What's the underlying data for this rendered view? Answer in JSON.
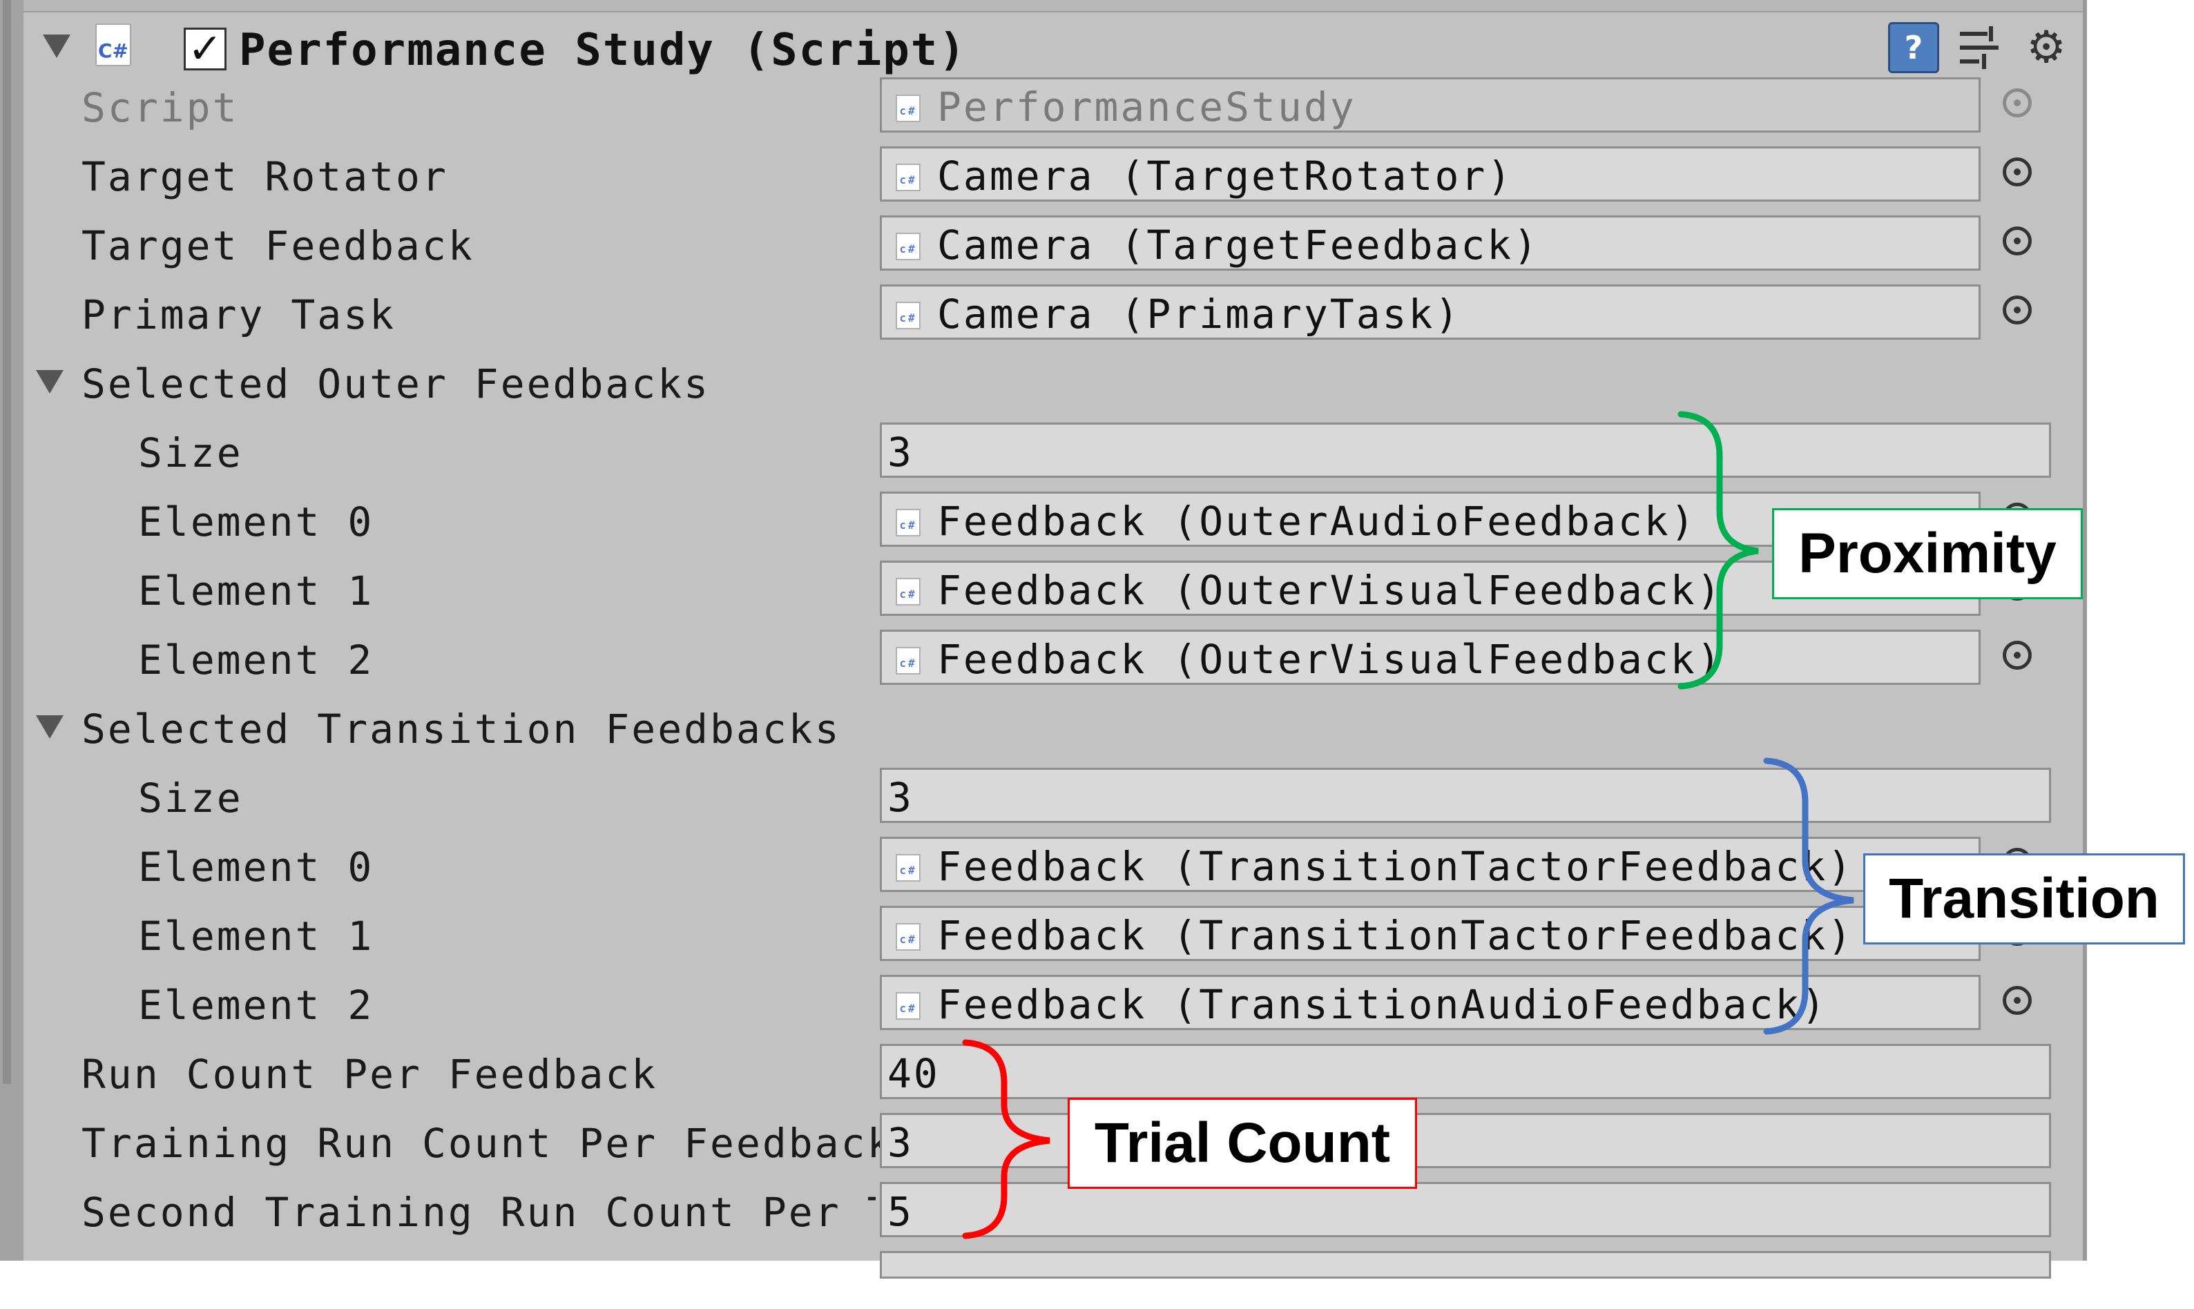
{
  "component": {
    "title": "Performance Study (Script)",
    "enabled": true,
    "icon_text": "C#",
    "icons": [
      "help-icon",
      "preset-icon",
      "gear-icon"
    ]
  },
  "fields": {
    "script": {
      "label": "Script",
      "value": "PerformanceStudy"
    },
    "target_rotator": {
      "label": "Target Rotator",
      "value": "Camera (TargetRotator)"
    },
    "target_feedback": {
      "label": "Target Feedback",
      "value": "Camera (TargetFeedback)"
    },
    "primary_task": {
      "label": "Primary Task",
      "value": "Camera (PrimaryTask)"
    }
  },
  "outer_feedbacks": {
    "label": "Selected Outer Feedbacks",
    "size_label": "Size",
    "size": "3",
    "elements": [
      {
        "label": "Element 0",
        "value": "Feedback (OuterAudioFeedback)"
      },
      {
        "label": "Element 1",
        "value": "Feedback (OuterVisualFeedback)"
      },
      {
        "label": "Element 2",
        "value": "Feedback (OuterVisualFeedback)"
      }
    ]
  },
  "transition_feedbacks": {
    "label": "Selected Transition Feedbacks",
    "size_label": "Size",
    "size": "3",
    "elements": [
      {
        "label": "Element 0",
        "value": "Feedback (TransitionTactorFeedback)"
      },
      {
        "label": "Element 1",
        "value": "Feedback (TransitionTactorFeedback)"
      },
      {
        "label": "Element 2",
        "value": "Feedback (TransitionAudioFeedback)"
      }
    ]
  },
  "counts": {
    "run": {
      "label": "Run Count Per Feedback",
      "value": "40"
    },
    "training": {
      "label": "Training Run Count Per Feedback",
      "value": "3"
    },
    "second_training": {
      "label": "Second Training Run Count Per Trai",
      "value": "5"
    }
  },
  "annotations": {
    "proximity": {
      "label": "Proximity",
      "color": "#00b050"
    },
    "transition": {
      "label": "Transition",
      "color": "#4472c4"
    },
    "trial_count": {
      "label": "Trial Count",
      "color": "#ff0000"
    }
  },
  "colors": {
    "panel_bg": "#c2c2c2",
    "field_bg": "#d9d9d9"
  }
}
